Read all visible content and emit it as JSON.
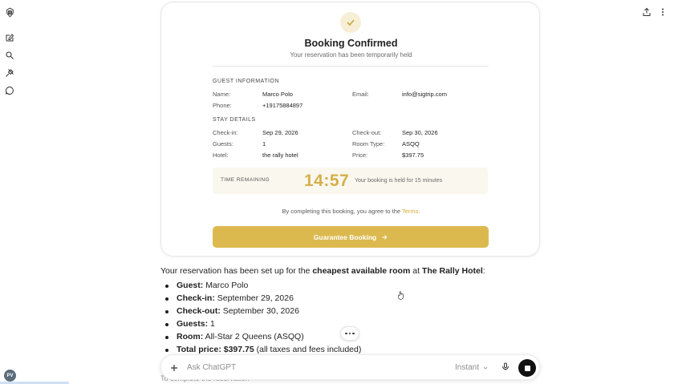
{
  "card": {
    "title": "Booking Confirmed",
    "subtitle": "Your reservation has been temporarily held",
    "guest_section": "GUEST INFORMATION",
    "stay_section": "STAY DETAILS",
    "guest": {
      "name_label": "Name:",
      "name": "Marco Polo",
      "email_label": "Email:",
      "email": "info@sigtrip.com",
      "phone_label": "Phone:",
      "phone": "+19175884897"
    },
    "stay": {
      "checkin_label": "Check-in:",
      "checkin": "Sep 29, 2026",
      "checkout_label": "Check-out:",
      "checkout": "Sep 30, 2026",
      "guests_label": "Guests:",
      "guests": "1",
      "room_label": "Room Type:",
      "room": "ASQQ",
      "hotel_label": "Hotel:",
      "hotel": "the rally hotel",
      "price_label": "Price:",
      "price": "$397.75"
    },
    "timer": {
      "label": "TIME REMAINING",
      "value": "14:57",
      "note": "Your booking is held for 15 minutes"
    },
    "terms_prefix": "By completing this booking, you agree to the",
    "terms_link": "Terms.",
    "button": "Guarantee Booking"
  },
  "message": {
    "intro_1": "Your reservation has been set up for the",
    "intro_bold_1": "cheapest available room",
    "intro_2": "at",
    "intro_bold_2": "The Rally Hotel",
    "intro_3": ":",
    "bullets": [
      {
        "label": "Guest:",
        "value": "Marco Polo"
      },
      {
        "label": "Check-in:",
        "value": "September 29, 2026"
      },
      {
        "label": "Check-out:",
        "value": "September 30, 2026"
      },
      {
        "label": "Guests:",
        "value": "1"
      },
      {
        "label": "Room:",
        "value": "All-Star 2 Queens (ASQQ)"
      },
      {
        "label": "Total price: $397.75",
        "value": "(all taxes and fees included)"
      }
    ],
    "trailing": "To complete the reservation"
  },
  "composer": {
    "placeholder": "Ask ChatGPT",
    "mode": "Instant"
  },
  "user": {
    "initials": "PV"
  },
  "colors": {
    "accent": "#dcb94f",
    "timer": "#d4b04a",
    "check_bg": "#f6efd5"
  },
  "icons": [
    "openai-logo-icon",
    "new-chat-icon",
    "search-icon",
    "pin-icon",
    "chat-bubble-icon",
    "share-icon",
    "kebab-icon",
    "check-icon",
    "arrow-right-icon",
    "plus-icon",
    "chevron-down-icon",
    "mic-icon",
    "stop-icon"
  ]
}
